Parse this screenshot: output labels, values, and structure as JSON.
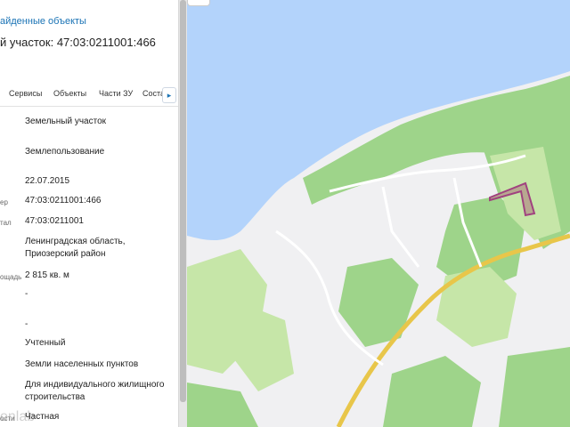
{
  "panel": {
    "found_link": "айденные объекты",
    "parcel_title": "й участок: 47:03:0211001:466",
    "tabs": [
      "Сервисы",
      "Объекты",
      "Части ЗУ",
      "Соста"
    ],
    "tab_next_icon": "chevron-right-icon",
    "rows": [
      {
        "label": "",
        "value": "Земельный участок"
      },
      {
        "label": "",
        "value": "Землепользование"
      },
      {
        "label": "",
        "value": "22.07.2015"
      },
      {
        "label": "ер",
        "value": "47:03:0211001:466"
      },
      {
        "label": "тал",
        "value": "47:03:0211001"
      },
      {
        "label": "",
        "value": "Ленинградская область, Приозерский район"
      },
      {
        "label": "ощадь",
        "value": "2 815 кв. м"
      },
      {
        "label": "",
        "value": "-"
      },
      {
        "label": "",
        "value": "-"
      },
      {
        "label": "",
        "value": "Учтенный"
      },
      {
        "label": "",
        "value": "Земли населенных пунктов"
      },
      {
        "label": "",
        "value": "Для индивидуального жилищного строительства"
      },
      {
        "label": "ости",
        "value": "Частная"
      }
    ],
    "watermark": "onlab"
  },
  "map": {
    "colors": {
      "water": "#b3d3fb",
      "forest": "#9ed48a",
      "light_forest": "#c6e6a8",
      "land": "#f0f0f2",
      "road": "#e8c64a",
      "parcel": "#a0427f"
    }
  }
}
